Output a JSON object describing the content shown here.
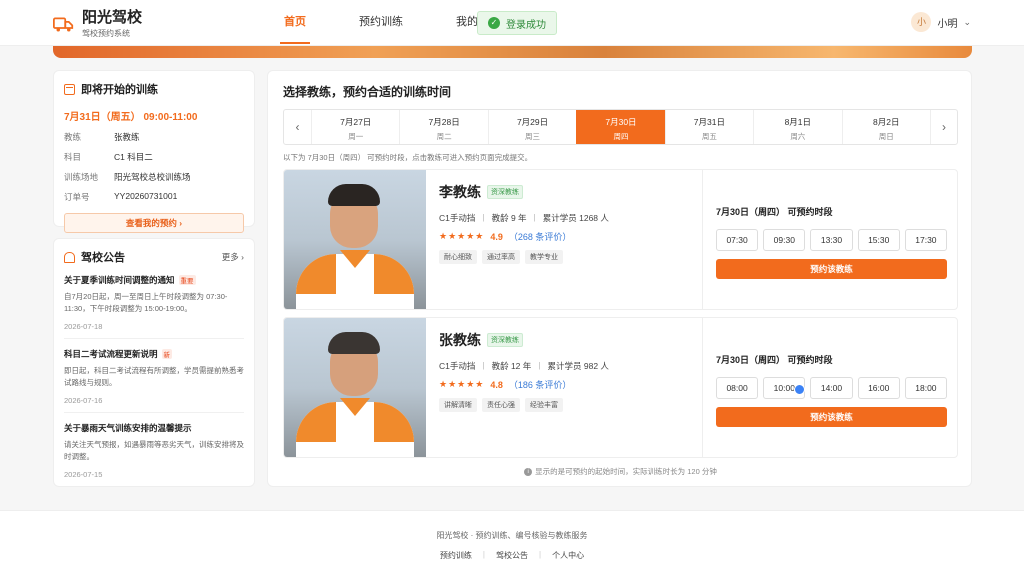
{
  "header": {
    "logo_title": "阳光驾校",
    "logo_sub": "驾校预约系统",
    "nav": [
      "首页",
      "预约训练",
      "我的预约"
    ],
    "toast": "登录成功",
    "user_avatar": "小",
    "user_name": "小明"
  },
  "upcoming": {
    "title": "即将开始的训练",
    "time": "7月31日（周五） 09:00-11:00",
    "rows": [
      {
        "k": "教练",
        "v": "张教练"
      },
      {
        "k": "科目",
        "v": "C1 科目二"
      },
      {
        "k": "训练场地",
        "v": "阳光驾校总校训练场"
      },
      {
        "k": "订单号",
        "v": "YY20260731001"
      }
    ],
    "button": "查看我的预约"
  },
  "notice": {
    "title": "驾校公告",
    "more": "更多",
    "items": [
      {
        "title": "关于夏季训练时间调整的通知",
        "tag": "重要",
        "body": "自7月20日起，周一至周日上午时段调整为 07:30-11:30，下午时段调整为 15:00-19:00。",
        "date": "2026-07-18"
      },
      {
        "title": "科目二考试流程更新说明",
        "tag": "新",
        "body": "即日起，科目二考试流程有所调整，学员需提前熟悉考试路线与规则。",
        "date": "2026-07-16"
      },
      {
        "title": "关于暴雨天气训练安排的温馨提示",
        "tag": "",
        "body": "请关注天气预报，如遇暴雨等恶劣天气，训练安排将及时调整。",
        "date": "2026-07-15"
      }
    ]
  },
  "main": {
    "title": "选择教练，预约合适的训练时间",
    "dates": [
      {
        "d": "7月27日",
        "w": "周一"
      },
      {
        "d": "7月28日",
        "w": "周二"
      },
      {
        "d": "7月29日",
        "w": "周三"
      },
      {
        "d": "7月30日",
        "w": "周四"
      },
      {
        "d": "7月31日",
        "w": "周五"
      },
      {
        "d": "8月1日",
        "w": "周六"
      },
      {
        "d": "8月2日",
        "w": "周日"
      }
    ],
    "hint": "以下为 7月30日（周四） 可预约时段，点击教练可进入预约页面完成提交。",
    "coaches": [
      {
        "name": "李教练",
        "badge": "资深教练",
        "type": "C1手动挡",
        "years": "教龄 9 年",
        "students": "累计学员 1268 人",
        "stars": "★★★★★",
        "score": "4.9",
        "reviews": "（268 条评价）",
        "tags": [
          "耐心细致",
          "通过率高",
          "教学专业"
        ],
        "slots_title": "7月30日（周四） 可预约时段",
        "slots": [
          "07:30",
          "09:30",
          "13:30",
          "15:30",
          "17:30"
        ],
        "book": "预约该教练"
      },
      {
        "name": "张教练",
        "badge": "资深教练",
        "type": "C1手动挡",
        "years": "教龄 12 年",
        "students": "累计学员 982 人",
        "stars": "★★★★★",
        "score": "4.8",
        "reviews": "（186 条评价）",
        "tags": [
          "讲解清晰",
          "责任心强",
          "经验丰富"
        ],
        "slots_title": "7月30日（周四） 可预约时段",
        "slots": [
          "08:00",
          "10:00",
          "14:00",
          "16:00",
          "18:00"
        ],
        "book": "预约该教练"
      }
    ],
    "footnote": "显示的是可预约的起始时间，实际训练时长为 120 分钟"
  },
  "footer": {
    "line": "阳光驾校 · 预约训练、编号核验与教练服务",
    "links": [
      "预约训练",
      "驾校公告",
      "个人中心"
    ]
  },
  "colors": {
    "accent": "#f26b1d",
    "success": "#3aa845",
    "link": "#3b7bd6"
  }
}
